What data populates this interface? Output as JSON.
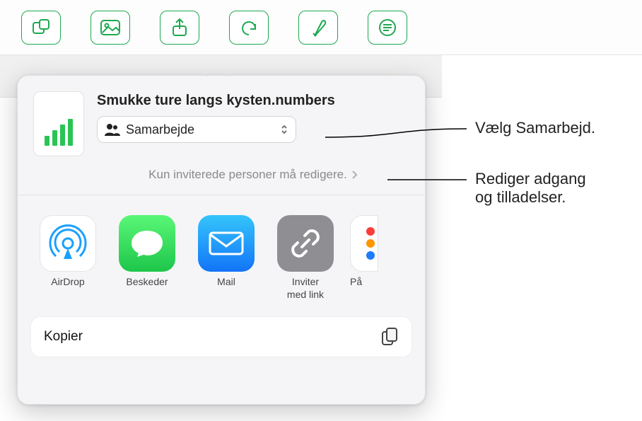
{
  "toolbar": {
    "items": [
      "insert-shape",
      "media",
      "share",
      "undo",
      "format",
      "more"
    ]
  },
  "sheet": {
    "filename": "Smukke ture langs kysten.numbers",
    "mode_label": "Samarbejde",
    "permission_text": "Kun inviterede personer må redigere.",
    "apps": [
      {
        "id": "airdrop",
        "label": "AirDrop"
      },
      {
        "id": "messages",
        "label": "Beskeder"
      },
      {
        "id": "mail",
        "label": "Mail"
      },
      {
        "id": "link",
        "label": "Inviter\nmed link"
      },
      {
        "id": "reminders",
        "label": "På"
      }
    ],
    "copy_label": "Kopier"
  },
  "callouts": {
    "collaborate": "Vælg Samarbejd.",
    "permissions": "Rediger adgang\nog tilladelser."
  }
}
